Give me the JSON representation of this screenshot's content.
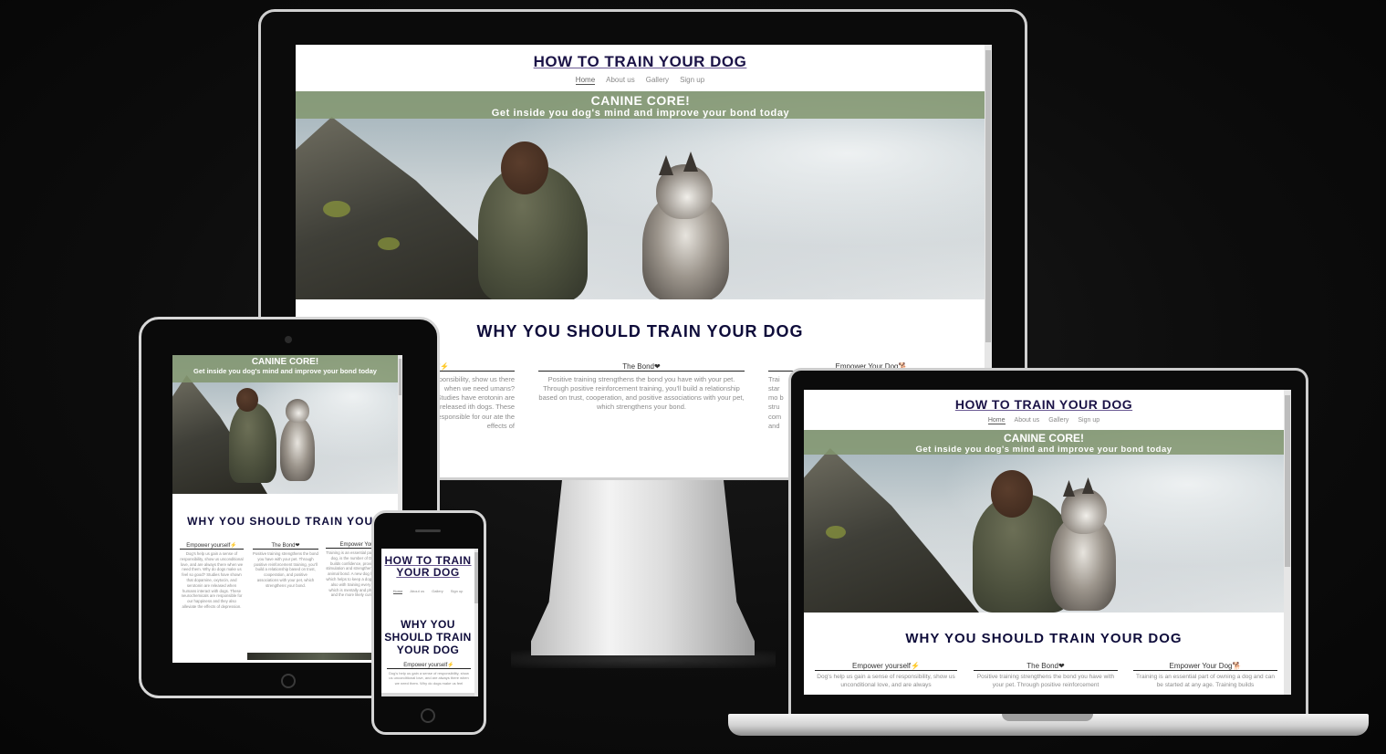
{
  "site": {
    "title": "HOW TO TRAIN YOUR DOG",
    "title_phone_line1": "HOW TO TRAIN",
    "title_phone_line2": "YOUR DOG",
    "nav": [
      {
        "label": "Home",
        "active": true
      },
      {
        "label": "About us",
        "active": false
      },
      {
        "label": "Gallery",
        "active": false
      },
      {
        "label": "Sign up",
        "active": false
      }
    ],
    "hero": {
      "heading": "CANINE CORE!",
      "subheading": "Get inside you dog's mind and improve your bond today"
    },
    "section_title": "WHY YOU SHOULD TRAIN YOUR DOG",
    "section_title_tablet": "WHY YOU SHOULD TRAIN YOUR D",
    "section_title_phone_lines": [
      "WHY YOU",
      "SHOULD TRAIN",
      "YOUR DOG"
    ],
    "columns": [
      {
        "heading": "Empower yourself⚡",
        "text_laptop": "Dog's help us gain a sense of responsibility, show us unconditional love, and are always",
        "text_tablet": "Dog's help us gain a sense of responsibility, show us unconditional love, and are always there when we need them. Why do dogs make us feel so good? Studies have shown that dopamine, oxytocin, and serotonin are released when humans interact with dogs. These neurochemicals are responsible for our happiness and they also alleviate the effects of depression.",
        "text_imac_fragment": "ponsibility, show us there when we need umans? Studies have erotonin are released ith dogs. These esponsible for our ate the effects of",
        "heading_imac_fragment": "f⚡",
        "text_phone": "Dog's help us gain a sense of responsibility, show us unconditional love, and are always there when we need them. Why do dogs make us feel"
      },
      {
        "heading": "The Bond❤",
        "text": "Positive training strengthens the bond you have with your pet. Through positive reinforcement training, you'll build a relationship based on trust, cooperation, and positive associations with your pet, which strengthens your bond.",
        "text_laptop": "Positive training strengthens the bond you have with your pet. Through positive reinforcement"
      },
      {
        "heading": "Empower Your Dog🐕",
        "heading_tablet": "Empower Your D",
        "text_laptop": "Training is an essential part of owning a dog and can be started at any age. Training builds",
        "text_tablet": "Training is an essential part of owning a dog, is the number of Dog training builds confidence, provides mental stimulation and strengthens the human-animal bond. A new dog learns better, which helps to keep a dog happy, and it also with training every day, a dog which is mentally and physically well and the more likely curing the dog",
        "text_imac_fragment": "Trai star mo b stru com and"
      }
    ]
  },
  "colors": {
    "background": "#0d0d0d",
    "title": "#1b1347",
    "banner": "#82966e",
    "section_title": "#0e0c3a"
  },
  "icons": [
    "bolt-icon",
    "heart-icon",
    "dog-icon"
  ]
}
